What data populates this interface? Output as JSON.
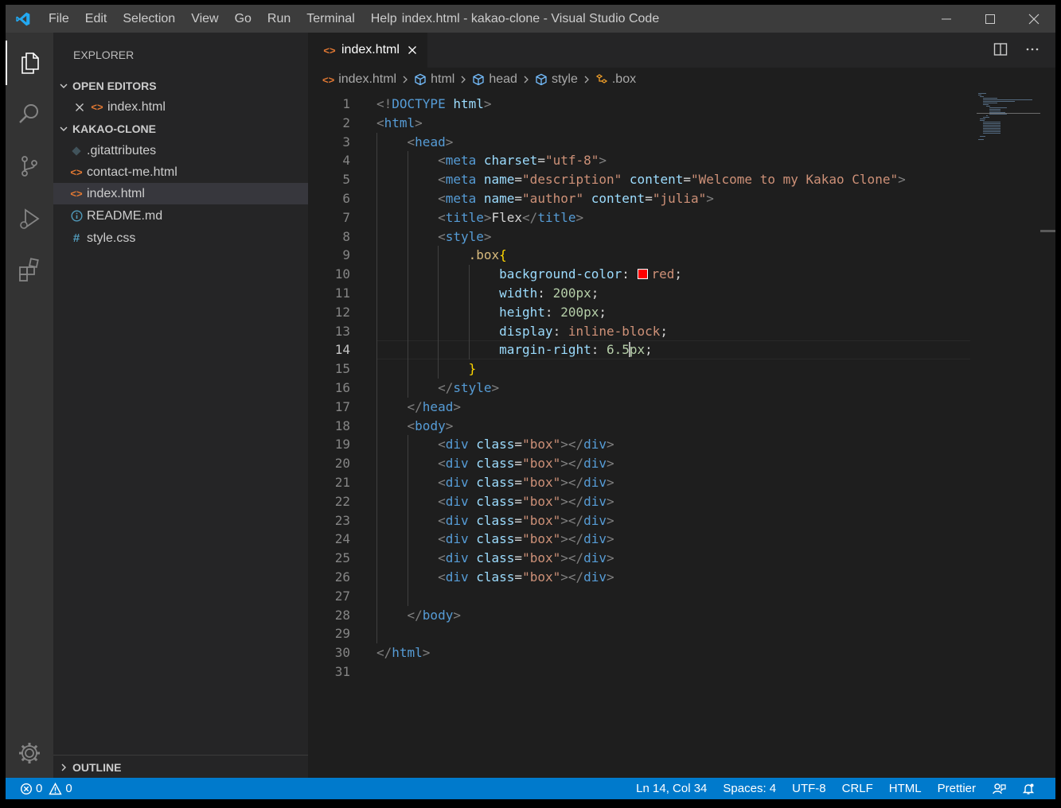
{
  "window": {
    "title": "index.html - kakao-clone - Visual Studio Code"
  },
  "menu": [
    "File",
    "Edit",
    "Selection",
    "View",
    "Go",
    "Run",
    "Terminal",
    "Help"
  ],
  "activity_bar": [
    "files-icon",
    "search-icon",
    "source-control-icon",
    "run-debug-icon",
    "extensions-icon",
    "settings-gear-icon"
  ],
  "sidebar": {
    "header": "EXPLORER",
    "open_editors": {
      "label": "OPEN EDITORS",
      "items": [
        {
          "name": "index.html",
          "icon": "html-icon"
        }
      ]
    },
    "project": {
      "label": "KAKAO-CLONE",
      "files": [
        {
          "name": ".gitattributes",
          "icon": "git-icon"
        },
        {
          "name": "contact-me.html",
          "icon": "html-icon"
        },
        {
          "name": "index.html",
          "icon": "html-icon",
          "selected": true
        },
        {
          "name": "README.md",
          "icon": "info-icon"
        },
        {
          "name": "style.css",
          "icon": "css-icon"
        }
      ]
    },
    "outline_label": "OUTLINE"
  },
  "tab": {
    "label": "index.html"
  },
  "breadcrumb": [
    "index.html",
    "html",
    "head",
    "style",
    ".box"
  ],
  "editor": {
    "lines": [
      [
        [
          "p",
          "<!"
        ],
        [
          "t",
          "DOCTYPE"
        ],
        [
          "d",
          " "
        ],
        [
          "a",
          "html"
        ],
        [
          "p",
          ">"
        ]
      ],
      [
        [
          "p",
          "<"
        ],
        [
          "t",
          "html"
        ],
        [
          "p",
          ">"
        ]
      ],
      [
        [
          "d",
          "    "
        ],
        [
          "p",
          "<"
        ],
        [
          "t",
          "head"
        ],
        [
          "p",
          ">"
        ]
      ],
      [
        [
          "d",
          "        "
        ],
        [
          "p",
          "<"
        ],
        [
          "t",
          "meta"
        ],
        [
          "d",
          " "
        ],
        [
          "a",
          "charset"
        ],
        [
          "d",
          "="
        ],
        [
          "s",
          "\"utf-8\""
        ],
        [
          "p",
          ">"
        ]
      ],
      [
        [
          "d",
          "        "
        ],
        [
          "p",
          "<"
        ],
        [
          "t",
          "meta"
        ],
        [
          "d",
          " "
        ],
        [
          "a",
          "name"
        ],
        [
          "d",
          "="
        ],
        [
          "s",
          "\"description\""
        ],
        [
          "d",
          " "
        ],
        [
          "a",
          "content"
        ],
        [
          "d",
          "="
        ],
        [
          "s",
          "\"Welcome to my Kakao Clone\""
        ],
        [
          "p",
          ">"
        ]
      ],
      [
        [
          "d",
          "        "
        ],
        [
          "p",
          "<"
        ],
        [
          "t",
          "meta"
        ],
        [
          "d",
          " "
        ],
        [
          "a",
          "name"
        ],
        [
          "d",
          "="
        ],
        [
          "s",
          "\"author\""
        ],
        [
          "d",
          " "
        ],
        [
          "a",
          "content"
        ],
        [
          "d",
          "="
        ],
        [
          "s",
          "\"julia\""
        ],
        [
          "p",
          ">"
        ]
      ],
      [
        [
          "d",
          "        "
        ],
        [
          "p",
          "<"
        ],
        [
          "t",
          "title"
        ],
        [
          "p",
          ">"
        ],
        [
          "d",
          "Flex"
        ],
        [
          "p",
          "</"
        ],
        [
          "t",
          "title"
        ],
        [
          "p",
          ">"
        ]
      ],
      [
        [
          "d",
          "        "
        ],
        [
          "p",
          "<"
        ],
        [
          "t",
          "style"
        ],
        [
          "p",
          ">"
        ]
      ],
      [
        [
          "d",
          "            "
        ],
        [
          "e",
          ".box"
        ],
        [
          "b",
          "{"
        ]
      ],
      [
        [
          "d",
          "                "
        ],
        [
          "a",
          "background-color"
        ],
        [
          "d",
          ": "
        ],
        [
          "w",
          ""
        ],
        [
          "v",
          "red"
        ],
        [
          "d",
          ";"
        ]
      ],
      [
        [
          "d",
          "                "
        ],
        [
          "a",
          "width"
        ],
        [
          "d",
          ": "
        ],
        [
          "n",
          "200px"
        ],
        [
          "d",
          ";"
        ]
      ],
      [
        [
          "d",
          "                "
        ],
        [
          "a",
          "height"
        ],
        [
          "d",
          ": "
        ],
        [
          "n",
          "200px"
        ],
        [
          "d",
          ";"
        ]
      ],
      [
        [
          "d",
          "                "
        ],
        [
          "a",
          "display"
        ],
        [
          "d",
          ": "
        ],
        [
          "v",
          "inline-block"
        ],
        [
          "d",
          ";"
        ]
      ],
      [
        [
          "d",
          "                "
        ],
        [
          "a",
          "margin-right"
        ],
        [
          "d",
          ": "
        ],
        [
          "n",
          "6.5"
        ],
        [
          "c",
          ""
        ],
        [
          "n",
          "px"
        ],
        [
          "d",
          ";"
        ]
      ],
      [
        [
          "d",
          "            "
        ],
        [
          "b",
          "}"
        ]
      ],
      [
        [
          "d",
          "        "
        ],
        [
          "p",
          "</"
        ],
        [
          "t",
          "style"
        ],
        [
          "p",
          ">"
        ]
      ],
      [
        [
          "d",
          "    "
        ],
        [
          "p",
          "</"
        ],
        [
          "t",
          "head"
        ],
        [
          "p",
          ">"
        ]
      ],
      [
        [
          "d",
          "    "
        ],
        [
          "p",
          "<"
        ],
        [
          "t",
          "body"
        ],
        [
          "p",
          ">"
        ]
      ],
      [
        [
          "d",
          "        "
        ],
        [
          "p",
          "<"
        ],
        [
          "t",
          "div"
        ],
        [
          "d",
          " "
        ],
        [
          "a",
          "class"
        ],
        [
          "d",
          "="
        ],
        [
          "s",
          "\"box\""
        ],
        [
          "p",
          "></"
        ],
        [
          "t",
          "div"
        ],
        [
          "p",
          ">"
        ]
      ],
      [
        [
          "d",
          "        "
        ],
        [
          "p",
          "<"
        ],
        [
          "t",
          "div"
        ],
        [
          "d",
          " "
        ],
        [
          "a",
          "class"
        ],
        [
          "d",
          "="
        ],
        [
          "s",
          "\"box\""
        ],
        [
          "p",
          "></"
        ],
        [
          "t",
          "div"
        ],
        [
          "p",
          ">"
        ]
      ],
      [
        [
          "d",
          "        "
        ],
        [
          "p",
          "<"
        ],
        [
          "t",
          "div"
        ],
        [
          "d",
          " "
        ],
        [
          "a",
          "class"
        ],
        [
          "d",
          "="
        ],
        [
          "s",
          "\"box\""
        ],
        [
          "p",
          "></"
        ],
        [
          "t",
          "div"
        ],
        [
          "p",
          ">"
        ]
      ],
      [
        [
          "d",
          "        "
        ],
        [
          "p",
          "<"
        ],
        [
          "t",
          "div"
        ],
        [
          "d",
          " "
        ],
        [
          "a",
          "class"
        ],
        [
          "d",
          "="
        ],
        [
          "s",
          "\"box\""
        ],
        [
          "p",
          "></"
        ],
        [
          "t",
          "div"
        ],
        [
          "p",
          ">"
        ]
      ],
      [
        [
          "d",
          "        "
        ],
        [
          "p",
          "<"
        ],
        [
          "t",
          "div"
        ],
        [
          "d",
          " "
        ],
        [
          "a",
          "class"
        ],
        [
          "d",
          "="
        ],
        [
          "s",
          "\"box\""
        ],
        [
          "p",
          "></"
        ],
        [
          "t",
          "div"
        ],
        [
          "p",
          ">"
        ]
      ],
      [
        [
          "d",
          "        "
        ],
        [
          "p",
          "<"
        ],
        [
          "t",
          "div"
        ],
        [
          "d",
          " "
        ],
        [
          "a",
          "class"
        ],
        [
          "d",
          "="
        ],
        [
          "s",
          "\"box\""
        ],
        [
          "p",
          "></"
        ],
        [
          "t",
          "div"
        ],
        [
          "p",
          ">"
        ]
      ],
      [
        [
          "d",
          "        "
        ],
        [
          "p",
          "<"
        ],
        [
          "t",
          "div"
        ],
        [
          "d",
          " "
        ],
        [
          "a",
          "class"
        ],
        [
          "d",
          "="
        ],
        [
          "s",
          "\"box\""
        ],
        [
          "p",
          "></"
        ],
        [
          "t",
          "div"
        ],
        [
          "p",
          ">"
        ]
      ],
      [
        [
          "d",
          "        "
        ],
        [
          "p",
          "<"
        ],
        [
          "t",
          "div"
        ],
        [
          "d",
          " "
        ],
        [
          "a",
          "class"
        ],
        [
          "d",
          "="
        ],
        [
          "s",
          "\"box\""
        ],
        [
          "p",
          "></"
        ],
        [
          "t",
          "div"
        ],
        [
          "p",
          ">"
        ]
      ],
      [],
      [
        [
          "d",
          "    "
        ],
        [
          "p",
          "</"
        ],
        [
          "t",
          "body"
        ],
        [
          "p",
          ">"
        ]
      ],
      [],
      [
        [
          "p",
          "</"
        ],
        [
          "t",
          "html"
        ],
        [
          "p",
          ">"
        ]
      ],
      []
    ],
    "current_line": 14
  },
  "status_bar": {
    "errors": "0",
    "warnings": "0",
    "position": "Ln 14, Col 34",
    "spaces": "Spaces: 4",
    "encoding": "UTF-8",
    "eol": "CRLF",
    "language": "HTML",
    "formatter": "Prettier"
  },
  "colors": {
    "status_bar": "#007acc",
    "activity_bar": "#333333",
    "sidebar": "#252526",
    "editor": "#1e1e1e",
    "tag": "#569cd6",
    "attribute": "#9cdcfe",
    "string": "#ce9178",
    "number": "#b5cea8",
    "selector": "#d7ba7d",
    "bracket": "#ffd700",
    "html_icon": "#e37933",
    "css_icon": "#519aba",
    "info_icon": "#519aba",
    "color_swatch": "#ff0000"
  }
}
